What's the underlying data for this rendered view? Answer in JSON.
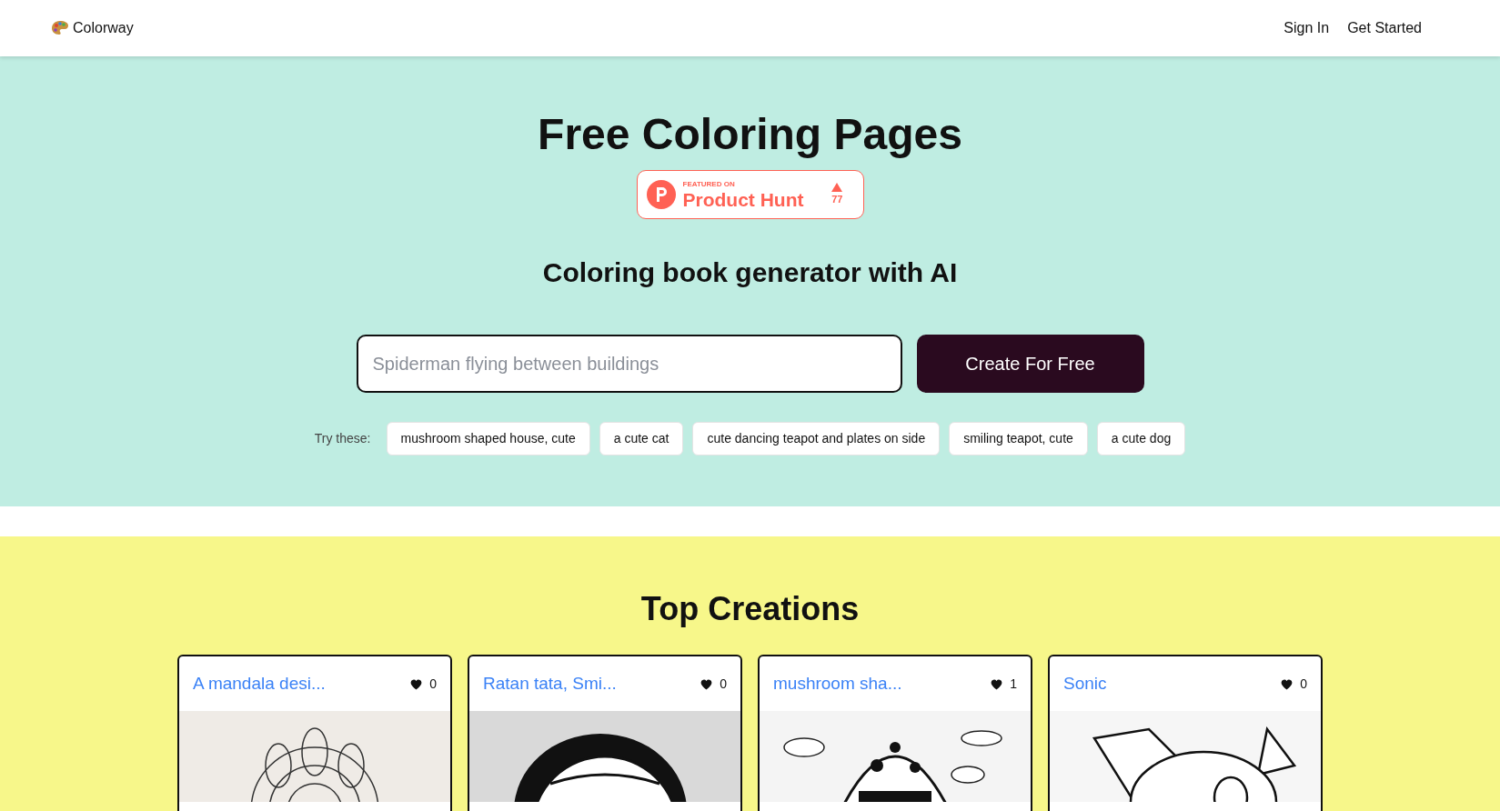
{
  "header": {
    "brand": "Colorway",
    "links": [
      "Sign In",
      "Get Started"
    ]
  },
  "hero": {
    "title": "Free Coloring Pages",
    "badge": {
      "kicker": "FEATURED ON",
      "name": "Product Hunt",
      "votes": "77"
    },
    "subtitle": "Coloring book generator with AI",
    "search": {
      "placeholder": "Spiderman flying between buildings"
    },
    "button": "Create For Free",
    "try_label": "Try these:",
    "suggestions": [
      "mushroom shaped house, cute",
      "a cute cat",
      "cute dancing teapot and plates on side",
      "smiling teapot, cute",
      "a cute dog"
    ]
  },
  "creations": {
    "title": "Top Creations",
    "cards": [
      {
        "title": "A mandala desi...",
        "likes": "0",
        "kind": "picture"
      },
      {
        "title": "Ratan tata, Smi...",
        "likes": "0",
        "kind": "picture"
      },
      {
        "title": "mushroom sha...",
        "likes": "1",
        "kind": "picture"
      },
      {
        "title": "Sonic",
        "likes": "0",
        "kind": "picture"
      }
    ]
  }
}
